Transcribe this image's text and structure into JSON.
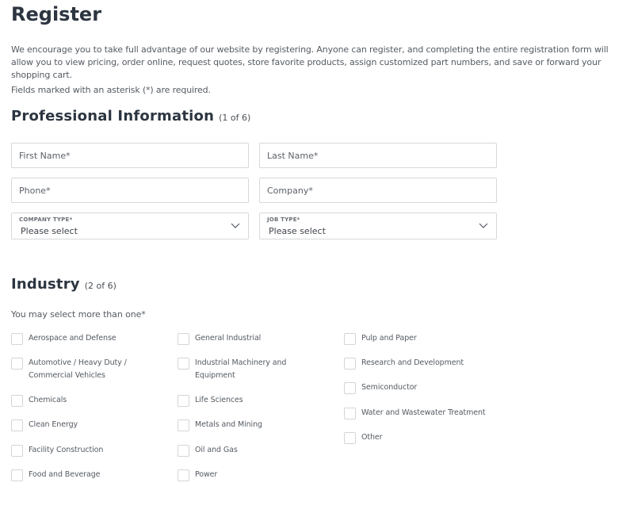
{
  "page": {
    "title": "Register",
    "intro": "We encourage you to take full advantage of our website by registering. Anyone can register, and completing the entire registration form will allow you to view pricing, order online, request quotes, store favorite products, assign customized part numbers, and save or forward your shopping cart.",
    "required_note": "Fields marked with an asterisk (*) are required."
  },
  "professional": {
    "title": "Professional Information",
    "step": "(1 of 6)",
    "first_name": {
      "placeholder": "First Name*",
      "value": ""
    },
    "last_name": {
      "placeholder": "Last Name*",
      "value": ""
    },
    "phone": {
      "placeholder": "Phone*",
      "value": ""
    },
    "company": {
      "placeholder": "Company*",
      "value": ""
    },
    "company_type": {
      "label": "COMPANY TYPE*",
      "value": "Please select",
      "icon": "chevron-down-icon"
    },
    "job_type": {
      "label": "JOB TYPE*",
      "value": "Please select",
      "icon": "chevron-down-icon"
    }
  },
  "industry": {
    "title": "Industry",
    "step": "(2 of 6)",
    "hint": "You may select more than one*",
    "columns": [
      [
        {
          "label": "Aerospace and Defense",
          "checked": false
        },
        {
          "label": "Automotive / Heavy Duty / Commercial Vehicles",
          "checked": false
        },
        {
          "label": "Chemicals",
          "checked": false
        },
        {
          "label": "Clean Energy",
          "checked": false
        },
        {
          "label": "Facility Construction",
          "checked": false
        },
        {
          "label": "Food and Beverage",
          "checked": false
        }
      ],
      [
        {
          "label": "General Industrial",
          "checked": false
        },
        {
          "label": "Industrial Machinery and Equipment",
          "checked": false
        },
        {
          "label": "Life Sciences",
          "checked": false
        },
        {
          "label": "Metals and Mining",
          "checked": false
        },
        {
          "label": "Oil and Gas",
          "checked": false
        },
        {
          "label": "Power",
          "checked": false
        }
      ],
      [
        {
          "label": "Pulp and Paper",
          "checked": false
        },
        {
          "label": "Research and Development",
          "checked": false
        },
        {
          "label": "Semiconductor",
          "checked": false
        },
        {
          "label": "Water and Wastewater Treatment",
          "checked": false
        },
        {
          "label": "Other",
          "checked": false
        }
      ]
    ]
  },
  "colors": {
    "heading": "#2c3540",
    "body_text": "#555b62",
    "border": "#d6d8da",
    "background": "#ffffff"
  }
}
